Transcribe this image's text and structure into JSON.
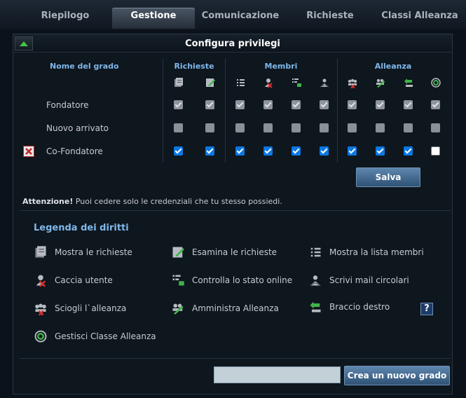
{
  "tabs": [
    {
      "label": "Riepilogo",
      "active": false
    },
    {
      "label": "Gestione",
      "active": true
    },
    {
      "label": "Comunicazione",
      "active": false
    },
    {
      "label": "Richieste",
      "active": false
    },
    {
      "label": "Classi Alleanza",
      "active": false
    }
  ],
  "section": {
    "title": "Configura privilegi"
  },
  "table": {
    "name_header": "Nome del grado",
    "groups": [
      "Richieste",
      "Membri",
      "Alleanza"
    ],
    "rows": [
      {
        "name": "Fondatore",
        "states": [
          "dis-checked",
          "dis-checked",
          "dis-checked",
          "dis-checked",
          "dis-checked",
          "dis-checked",
          "dis-checked",
          "dis-checked",
          "dis-checked",
          "dis-checked"
        ]
      },
      {
        "name": "Nuovo arrivato",
        "states": [
          "dis-empty",
          "dis-empty",
          "dis-empty",
          "dis-empty",
          "dis-empty",
          "dis-empty",
          "dis-empty",
          "dis-empty",
          "dis-empty",
          "dis-empty"
        ]
      },
      {
        "name": "Co-Fondatore",
        "states": [
          "checked",
          "checked",
          "checked",
          "checked",
          "checked",
          "checked",
          "checked",
          "checked",
          "checked",
          "empty"
        ]
      }
    ]
  },
  "save_label": "Salva",
  "warning": {
    "strong": "Attenzione!",
    "text": " Puoi cedere solo le credenziali che tu stesso possiedi."
  },
  "legend": {
    "title": "Legenda dei diritti",
    "items": [
      {
        "label": "Mostra le richieste",
        "icon": "show-requests-icon"
      },
      {
        "label": "Esamina le richieste",
        "icon": "examine-requests-icon"
      },
      {
        "label": "Mostra la lista membri",
        "icon": "member-list-icon"
      },
      {
        "label": "Caccia utente",
        "icon": "kick-user-icon"
      },
      {
        "label": "Controlla lo stato online",
        "icon": "online-status-icon"
      },
      {
        "label": "Scrivi mail circolari",
        "icon": "circular-mail-icon"
      },
      {
        "label": "Sciogli l`alleanza",
        "icon": "dissolve-alliance-icon"
      },
      {
        "label": "Amministra Alleanza",
        "icon": "manage-alliance-icon"
      },
      {
        "label": "Braccio destro",
        "icon": "right-hand-icon"
      },
      {
        "label": "Gestisci Classe Alleanza",
        "icon": "alliance-class-icon"
      }
    ]
  },
  "help_label": "?",
  "new_grade": {
    "value": "",
    "button_label": "Crea un nuovo grado"
  }
}
